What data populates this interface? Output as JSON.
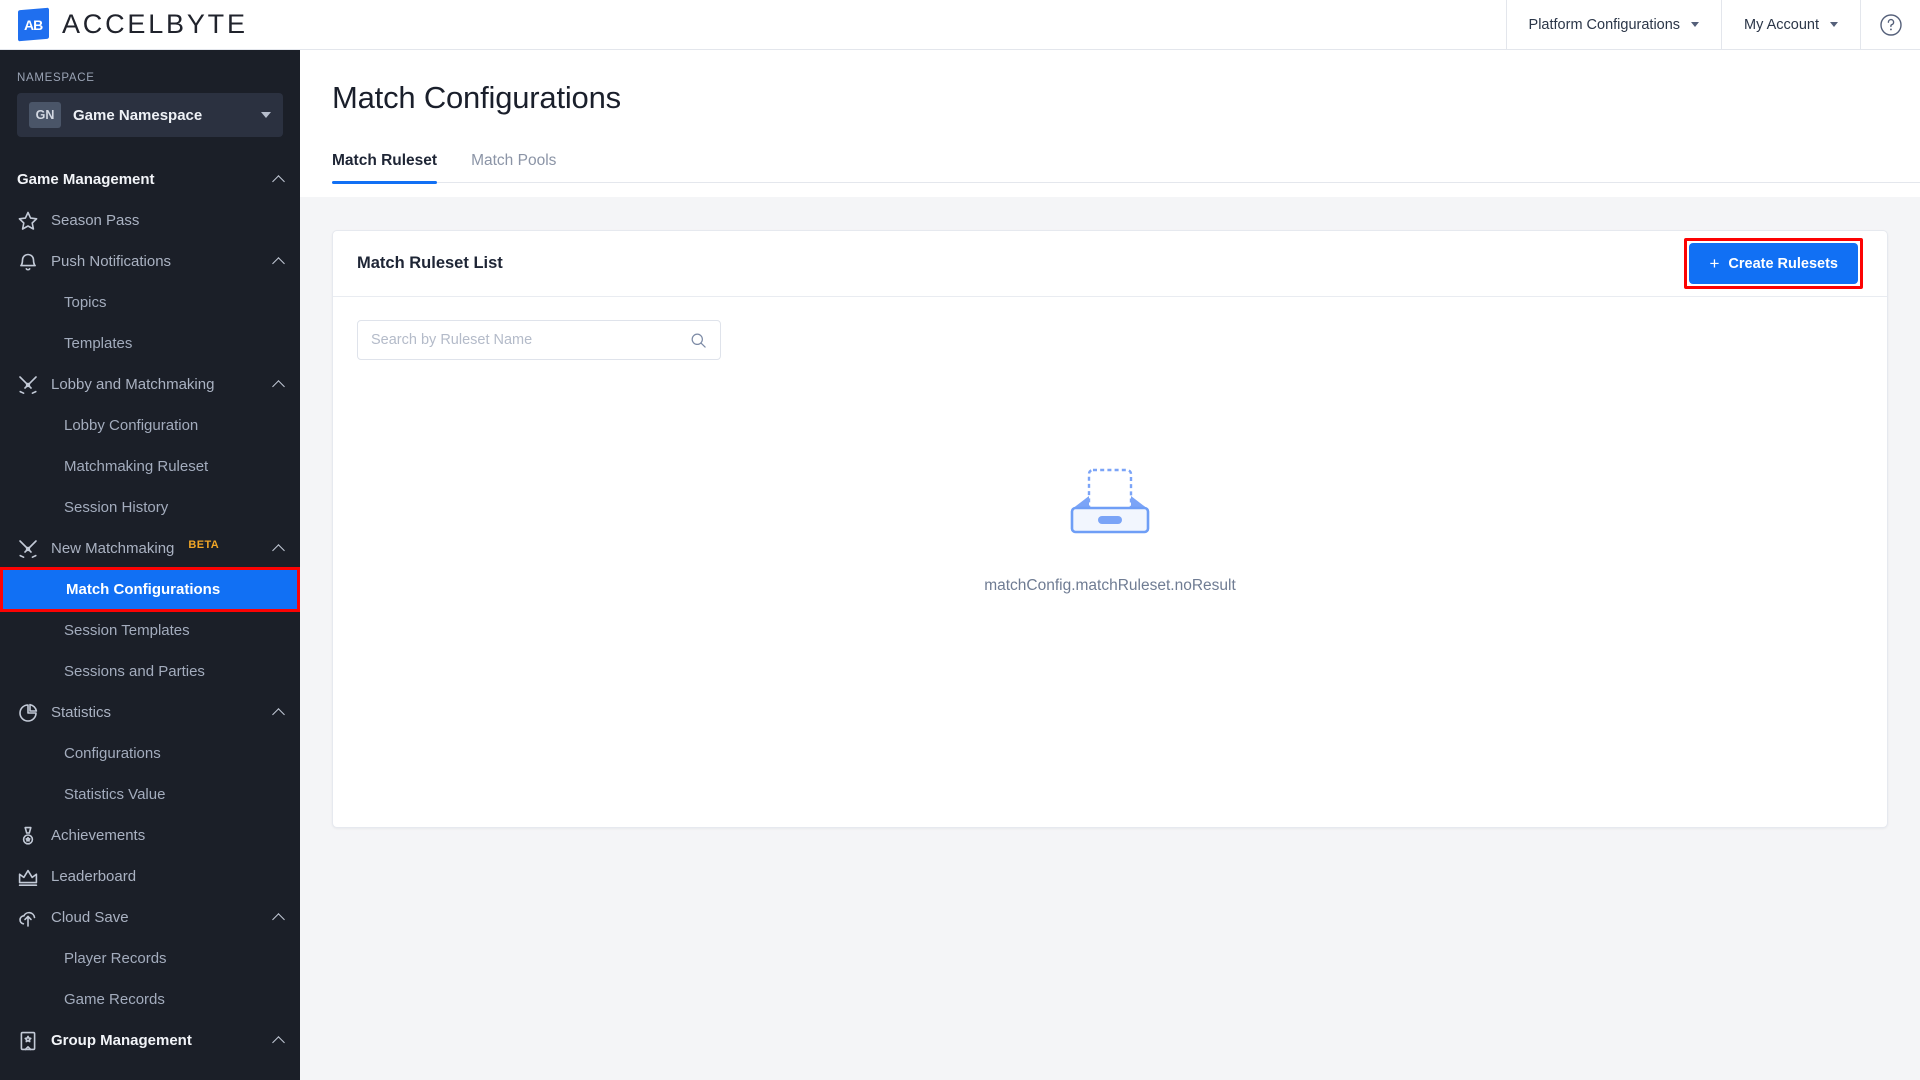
{
  "header": {
    "brand_initials": "AB",
    "brand_name": "ACCELBYTE",
    "platform_configurations": "Platform Configurations",
    "my_account": "My Account",
    "help": "?"
  },
  "sidebar": {
    "namespace_label": "NAMESPACE",
    "namespace_badge": "GN",
    "namespace_value": "Game Namespace",
    "nav": [
      {
        "type": "group",
        "label": "Game Management",
        "icon": "none",
        "chevron": "up"
      },
      {
        "type": "item",
        "label": "Season Pass",
        "icon": "star-icon"
      },
      {
        "type": "item",
        "label": "Push Notifications",
        "icon": "bell-icon",
        "chevron": "up"
      },
      {
        "type": "sub",
        "label": "Topics"
      },
      {
        "type": "sub",
        "label": "Templates"
      },
      {
        "type": "item",
        "label": "Lobby and Matchmaking",
        "icon": "crossed-swords-icon",
        "chevron": "up"
      },
      {
        "type": "sub",
        "label": "Lobby Configuration"
      },
      {
        "type": "sub",
        "label": "Matchmaking Ruleset"
      },
      {
        "type": "sub",
        "label": "Session History"
      },
      {
        "type": "item",
        "label": "New Matchmaking",
        "icon": "crossed-swords-icon",
        "badge": "BETA",
        "chevron": "up"
      },
      {
        "type": "sub",
        "label": "Match Configurations",
        "active": true
      },
      {
        "type": "sub",
        "label": "Session Templates"
      },
      {
        "type": "sub",
        "label": "Sessions and Parties"
      },
      {
        "type": "item",
        "label": "Statistics",
        "icon": "pie-chart-icon",
        "chevron": "up"
      },
      {
        "type": "sub",
        "label": "Configurations"
      },
      {
        "type": "sub",
        "label": "Statistics Value"
      },
      {
        "type": "item",
        "label": "Achievements",
        "icon": "medal-icon"
      },
      {
        "type": "item",
        "label": "Leaderboard",
        "icon": "crown-icon"
      },
      {
        "type": "item",
        "label": "Cloud Save",
        "icon": "cloud-upload-icon",
        "chevron": "up"
      },
      {
        "type": "sub",
        "label": "Player Records"
      },
      {
        "type": "sub",
        "label": "Game Records"
      },
      {
        "type": "group",
        "label": "Group Management",
        "icon": "banner-icon",
        "chevron": "up"
      }
    ]
  },
  "main": {
    "page_title": "Match Configurations",
    "tabs": [
      {
        "label": "Match Ruleset",
        "active": true
      },
      {
        "label": "Match Pools",
        "active": false
      }
    ],
    "card": {
      "title": "Match Ruleset List",
      "create_button": "Create Rulesets",
      "create_button_plus": "+",
      "search_placeholder": "Search by Ruleset Name",
      "search_value": "",
      "empty_text": "matchConfig.matchRuleset.noResult"
    }
  },
  "colors": {
    "accent_blue": "#1170f4",
    "highlight_red": "#fc0303",
    "sidebar_bg": "#1b1f28",
    "page_bg": "#f4f5f7",
    "beta_amber": "#f0a526"
  }
}
